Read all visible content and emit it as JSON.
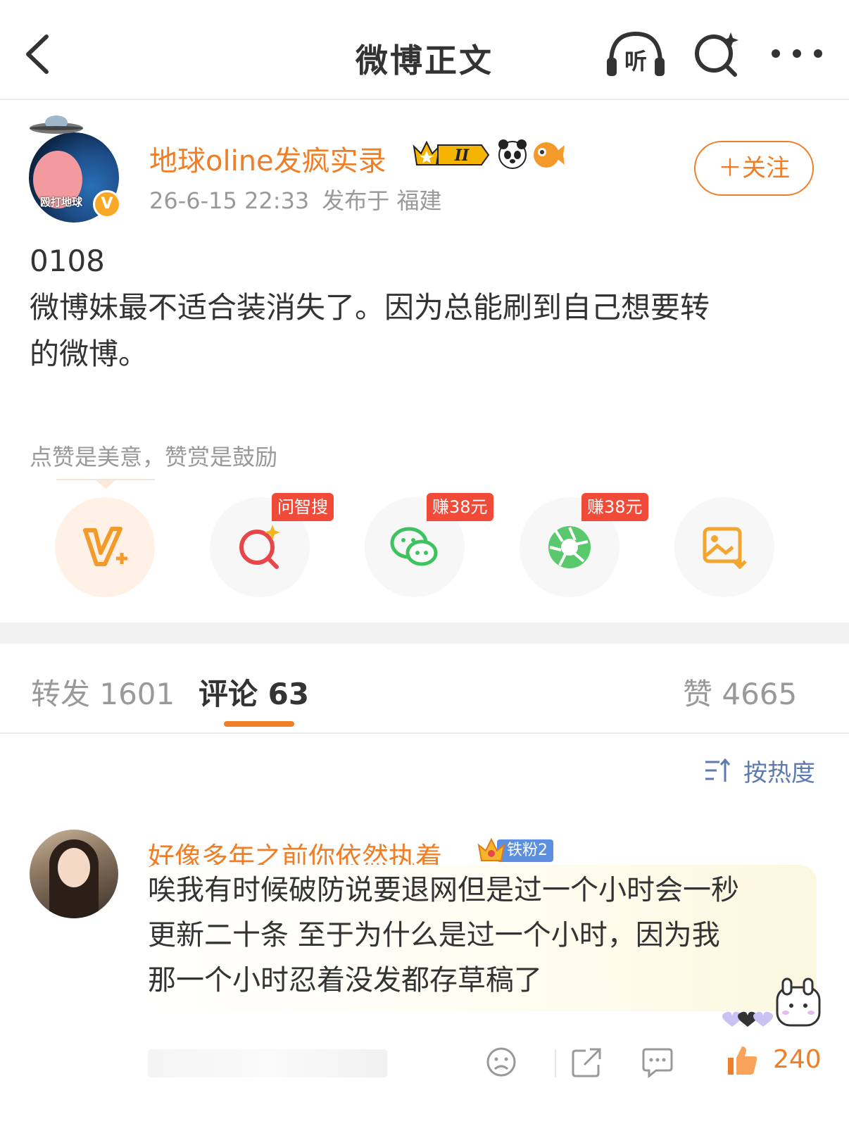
{
  "header": {
    "title": "微博正文",
    "listen_label": "听"
  },
  "author": {
    "name": "地球oline发疯实录",
    "avatar_caption": "殴打地球",
    "verified_mark": "V",
    "member_level": "II",
    "time": "26-6-15 22:33",
    "location": "发布于 福建",
    "follow_label": "＋关注"
  },
  "post": {
    "lines": [
      "0108",
      "微博妹最不适合装消失了。因为总能刷到自己想要转",
      "的微博。"
    ]
  },
  "reward_tip": "点赞是美意，赞赏是鼓励",
  "share": {
    "items": [
      {
        "icon": "vip-plus-icon",
        "tag": ""
      },
      {
        "icon": "smart-search-icon",
        "tag": "问智搜"
      },
      {
        "icon": "wechat-icon",
        "tag": "赚38元"
      },
      {
        "icon": "moments-icon",
        "tag": "赚38元"
      },
      {
        "icon": "save-image-icon",
        "tag": ""
      }
    ]
  },
  "tabs": {
    "repost": "转发 1601",
    "comment": "评论 63",
    "like": "赞 4665"
  },
  "sort_label": "按热度",
  "comment": {
    "name": "好像多年之前你依然执着",
    "fan_badge": "铁粉2",
    "lines": [
      "唉我有时候破防说要退网但是过一个小时会一秒",
      "更新二十条 至于为什么是过一个小时，因为我",
      "那一个小时忍着没发都存草稿了"
    ],
    "like_count": "240"
  },
  "colors": {
    "accent": "#f07e27",
    "tag_red": "#f04a39",
    "link_blue": "#5d7bb0"
  }
}
